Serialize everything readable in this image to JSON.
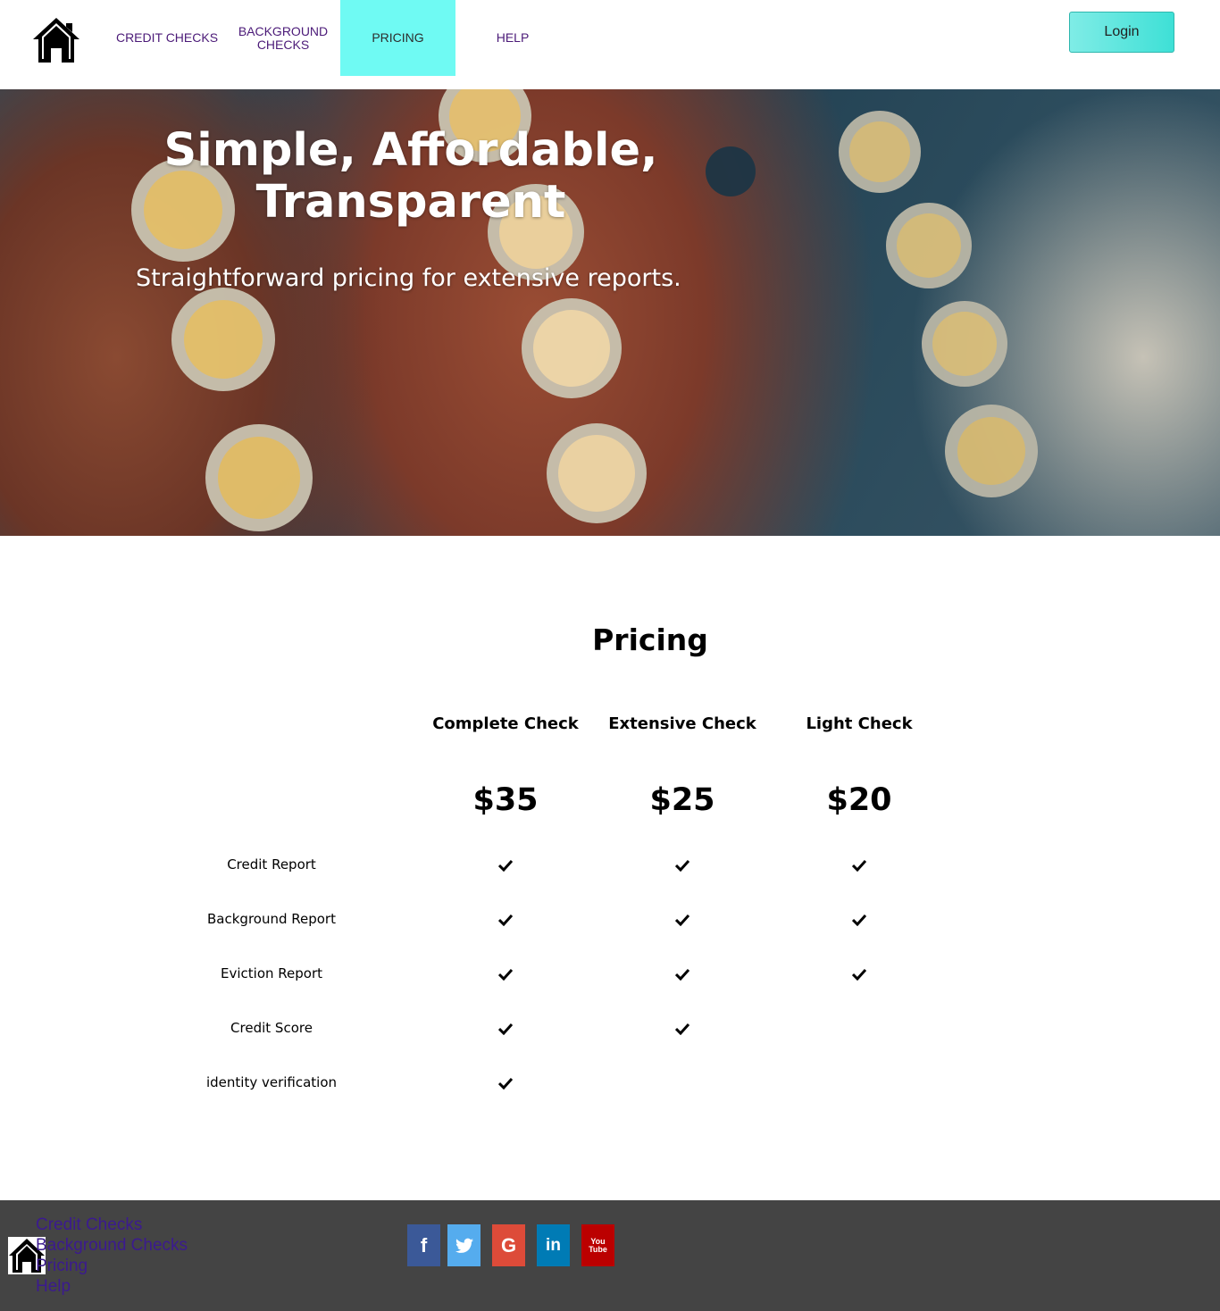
{
  "nav": {
    "items": [
      {
        "label": "Credit Checks"
      },
      {
        "label": "Background Checks"
      },
      {
        "label": "Pricing",
        "active": true
      },
      {
        "label": "Help"
      }
    ],
    "login_label": "Login",
    "active_color": "#6ffaf3",
    "link_color": "#4b1a78"
  },
  "hero": {
    "title_line1": "Simple, Affordable,",
    "title_line2": "Transparent",
    "subtitle": "Straightforward pricing for extensive reports."
  },
  "pricing": {
    "title": "Pricing",
    "plans": [
      {
        "name": "Complete Check",
        "price": "$35"
      },
      {
        "name": "Extensive Check",
        "price": "$25"
      },
      {
        "name": "Light Check",
        "price": "$20"
      }
    ],
    "features": [
      {
        "label": "Credit Report",
        "included": [
          true,
          true,
          true
        ]
      },
      {
        "label": "Background Report",
        "included": [
          true,
          true,
          true
        ]
      },
      {
        "label": "Eviction Report",
        "included": [
          true,
          true,
          true
        ]
      },
      {
        "label": "Credit Score",
        "included": [
          true,
          true,
          false
        ]
      },
      {
        "label": "identity verification",
        "included": [
          true,
          false,
          false
        ]
      }
    ]
  },
  "footer": {
    "links": [
      {
        "label": "Credit Checks"
      },
      {
        "label": "Background Checks"
      },
      {
        "label": "Pricing"
      },
      {
        "label": "Help"
      }
    ],
    "social": [
      {
        "icon": "facebook-icon",
        "glyph": "f",
        "color": "#3b5998"
      },
      {
        "icon": "twitter-icon",
        "glyph": "t",
        "color": "#55acee"
      },
      {
        "icon": "google-icon",
        "glyph": "G",
        "color": "#dd4b39"
      },
      {
        "icon": "linkedin-icon",
        "glyph": "in",
        "color": "#007bb5"
      },
      {
        "icon": "youtube-icon",
        "glyph": "You\nTube",
        "color": "#bb0000"
      }
    ],
    "background": "#444444"
  }
}
